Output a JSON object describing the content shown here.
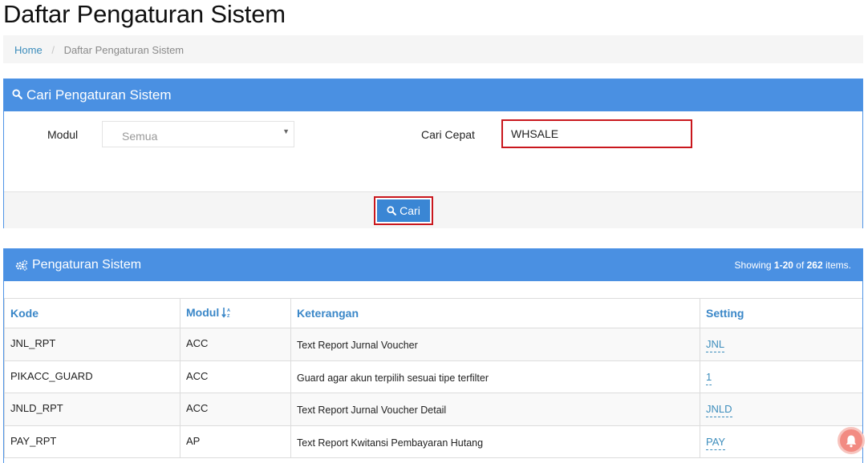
{
  "page": {
    "title": "Daftar Pengaturan Sistem"
  },
  "breadcrumb": {
    "home": "Home",
    "separator": "/",
    "current": "Daftar Pengaturan Sistem"
  },
  "search_panel": {
    "title": "Cari Pengaturan Sistem",
    "modul_label": "Modul",
    "modul_value": "Semua",
    "quick_label": "Cari Cepat",
    "quick_value": "WHSALE",
    "button_label": "Cari"
  },
  "table_panel": {
    "title": "Pengaturan Sistem",
    "summary_prefix": "Showing ",
    "summary_range": "1-20",
    "summary_of": " of ",
    "summary_total": "262",
    "summary_suffix": " items.",
    "columns": [
      "Kode",
      "Modul",
      "Keterangan",
      "Setting"
    ],
    "rows": [
      {
        "kode": "JNL_RPT",
        "modul": "ACC",
        "keterangan": "Text Report Jurnal Voucher",
        "setting": "JNL"
      },
      {
        "kode": "PIKACC_GUARD",
        "modul": "ACC",
        "keterangan": "Guard agar akun terpilih sesuai tipe terfilter",
        "setting": "1"
      },
      {
        "kode": "JNLD_RPT",
        "modul": "ACC",
        "keterangan": "Text Report Jurnal Voucher Detail",
        "setting": "JNLD"
      },
      {
        "kode": "PAY_RPT",
        "modul": "AP",
        "keterangan": "Text Report Kwitansi Pembayaran Hutang",
        "setting": "PAY"
      }
    ]
  },
  "icons": {
    "search": "search-icon",
    "gears": "gears-icon",
    "sort": "sort-alpha-icon",
    "bell": "bell-icon",
    "caret": "caret-down-icon"
  },
  "colors": {
    "panel_header": "#4a90e2",
    "link": "#3c8dbc",
    "highlight_border": "#c9171d",
    "column_header": "#3a87c8"
  }
}
